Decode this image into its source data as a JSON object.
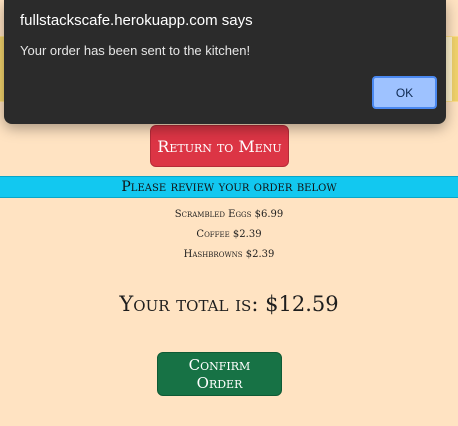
{
  "dialog": {
    "title": "fullstackscafe.herokuapp.com says",
    "message": "Your order has been sent to the kitchen!",
    "ok_label": "OK"
  },
  "page": {
    "return_button_label": "Return to Menu",
    "review_heading": "Please review your order below",
    "order_items": [
      "Scrambled Eggs $6.99",
      "Coffee $2.39",
      "Hashbrowns $2.39"
    ],
    "total_label": "Your total is:",
    "total_amount": "$12.59",
    "confirm_button_label": "Confirm Order"
  },
  "colors": {
    "page_background": "#ffe3c2",
    "alert_background": "#fff3cd",
    "return_button": "#dc3545",
    "review_bar": "#12c8f0",
    "confirm_button": "#177245",
    "dialog_background": "#2b2b2b",
    "dialog_ok_button": "#9ec2ff"
  }
}
